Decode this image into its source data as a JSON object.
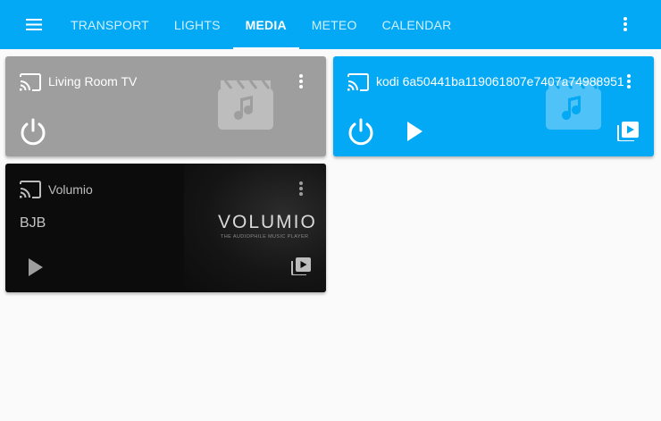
{
  "toolbar": {
    "tabs": [
      {
        "label": "TRANSPORT",
        "active": false
      },
      {
        "label": "LIGHTS",
        "active": false
      },
      {
        "label": "MEDIA",
        "active": true
      },
      {
        "label": "METEO",
        "active": false
      },
      {
        "label": "CALENDAR",
        "active": false
      }
    ],
    "menu_icon": "hamburger-menu-icon",
    "overflow_icon": "more-vert-icon",
    "color": "#03a9f4"
  },
  "cards": {
    "living_room": {
      "title": "Living Room TV",
      "state": "off",
      "color": "#9e9e9e",
      "icons": [
        "cast-icon",
        "more-vert-icon",
        "video-placeholder-icon",
        "power-icon"
      ]
    },
    "kodi": {
      "title": "kodi 6a50441ba119061807e7407a74988951",
      "state": "idle",
      "color": "#03a9f4",
      "icons": [
        "cast-icon",
        "more-vert-icon",
        "video-placeholder-icon",
        "power-icon",
        "play-icon",
        "queue-play-icon"
      ]
    },
    "volumio": {
      "title": "Volumio",
      "track": "BJB",
      "logo_text": "VOLUMIO",
      "logo_tagline": "THE AUDIOPHILE MUSIC PLAYER",
      "color": "#0c0c0c",
      "icons": [
        "cast-icon",
        "more-vert-icon",
        "play-icon",
        "queue-play-icon"
      ]
    }
  }
}
